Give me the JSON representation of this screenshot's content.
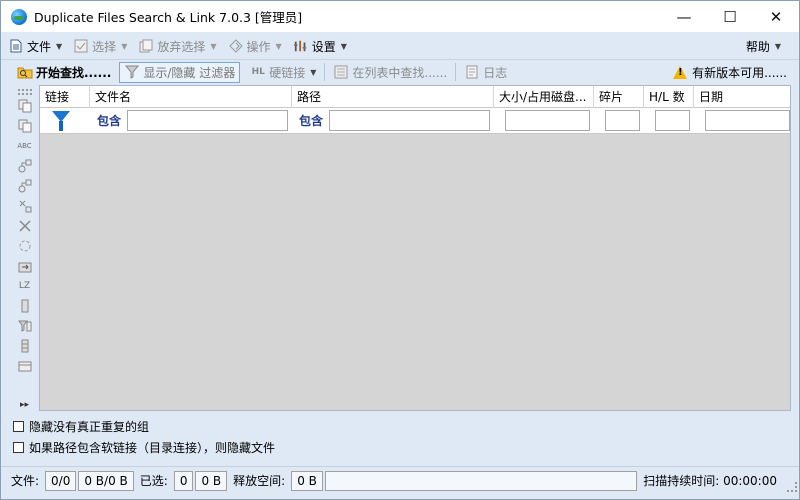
{
  "window": {
    "title": "Duplicate Files Search & Link 7.0.3 [管理员]",
    "minimize_symbol": "—",
    "maximize_symbol": "☐",
    "close_symbol": "✕"
  },
  "menu": {
    "file": "文件",
    "select": "选择",
    "deselect": "放弃选择",
    "actions": "操作",
    "settings": "设置",
    "help": "帮助"
  },
  "toolbar": {
    "start_search": "开始查找......",
    "toggle_filter": "显示/隐藏 过滤器",
    "hardlink_icon_text": "HL",
    "hardlink": "硬链接",
    "find_in_list": "在列表中查找......",
    "log": "日志",
    "update_available": "有新版本可用......"
  },
  "grid": {
    "columns": [
      "链接",
      "文件名",
      "路径",
      "大小/占用磁盘...",
      "碎片",
      "H/L 数",
      "日期"
    ],
    "filter": {
      "name_contains_label": "包含",
      "path_contains_label": "包含",
      "name_value": "",
      "path_value": "",
      "size_value": "",
      "fragments_value": "",
      "hl_value": "",
      "date_value": ""
    }
  },
  "sidebar_lz_label": "LZ",
  "options": {
    "hide_non_duplicate": "隐藏没有真正重复的组",
    "hide_symlinks": "如果路径包含软链接（目录连接），则隐藏文件"
  },
  "status": {
    "files_label": "文件:",
    "files_count": "0/0",
    "files_size": "0 B/0 B",
    "selected_label": "已选:",
    "selected_count": "0",
    "selected_size": "0 B",
    "free_space_label": "释放空间:",
    "free_space_value": "0 B",
    "scan_duration": "扫描持续时间: 00:00:00"
  },
  "colors": {
    "accent_blue": "#1976d2",
    "window_bg": "#dfe9f5",
    "grid_bg": "#d5d5d5",
    "warning": "#f2b600"
  }
}
